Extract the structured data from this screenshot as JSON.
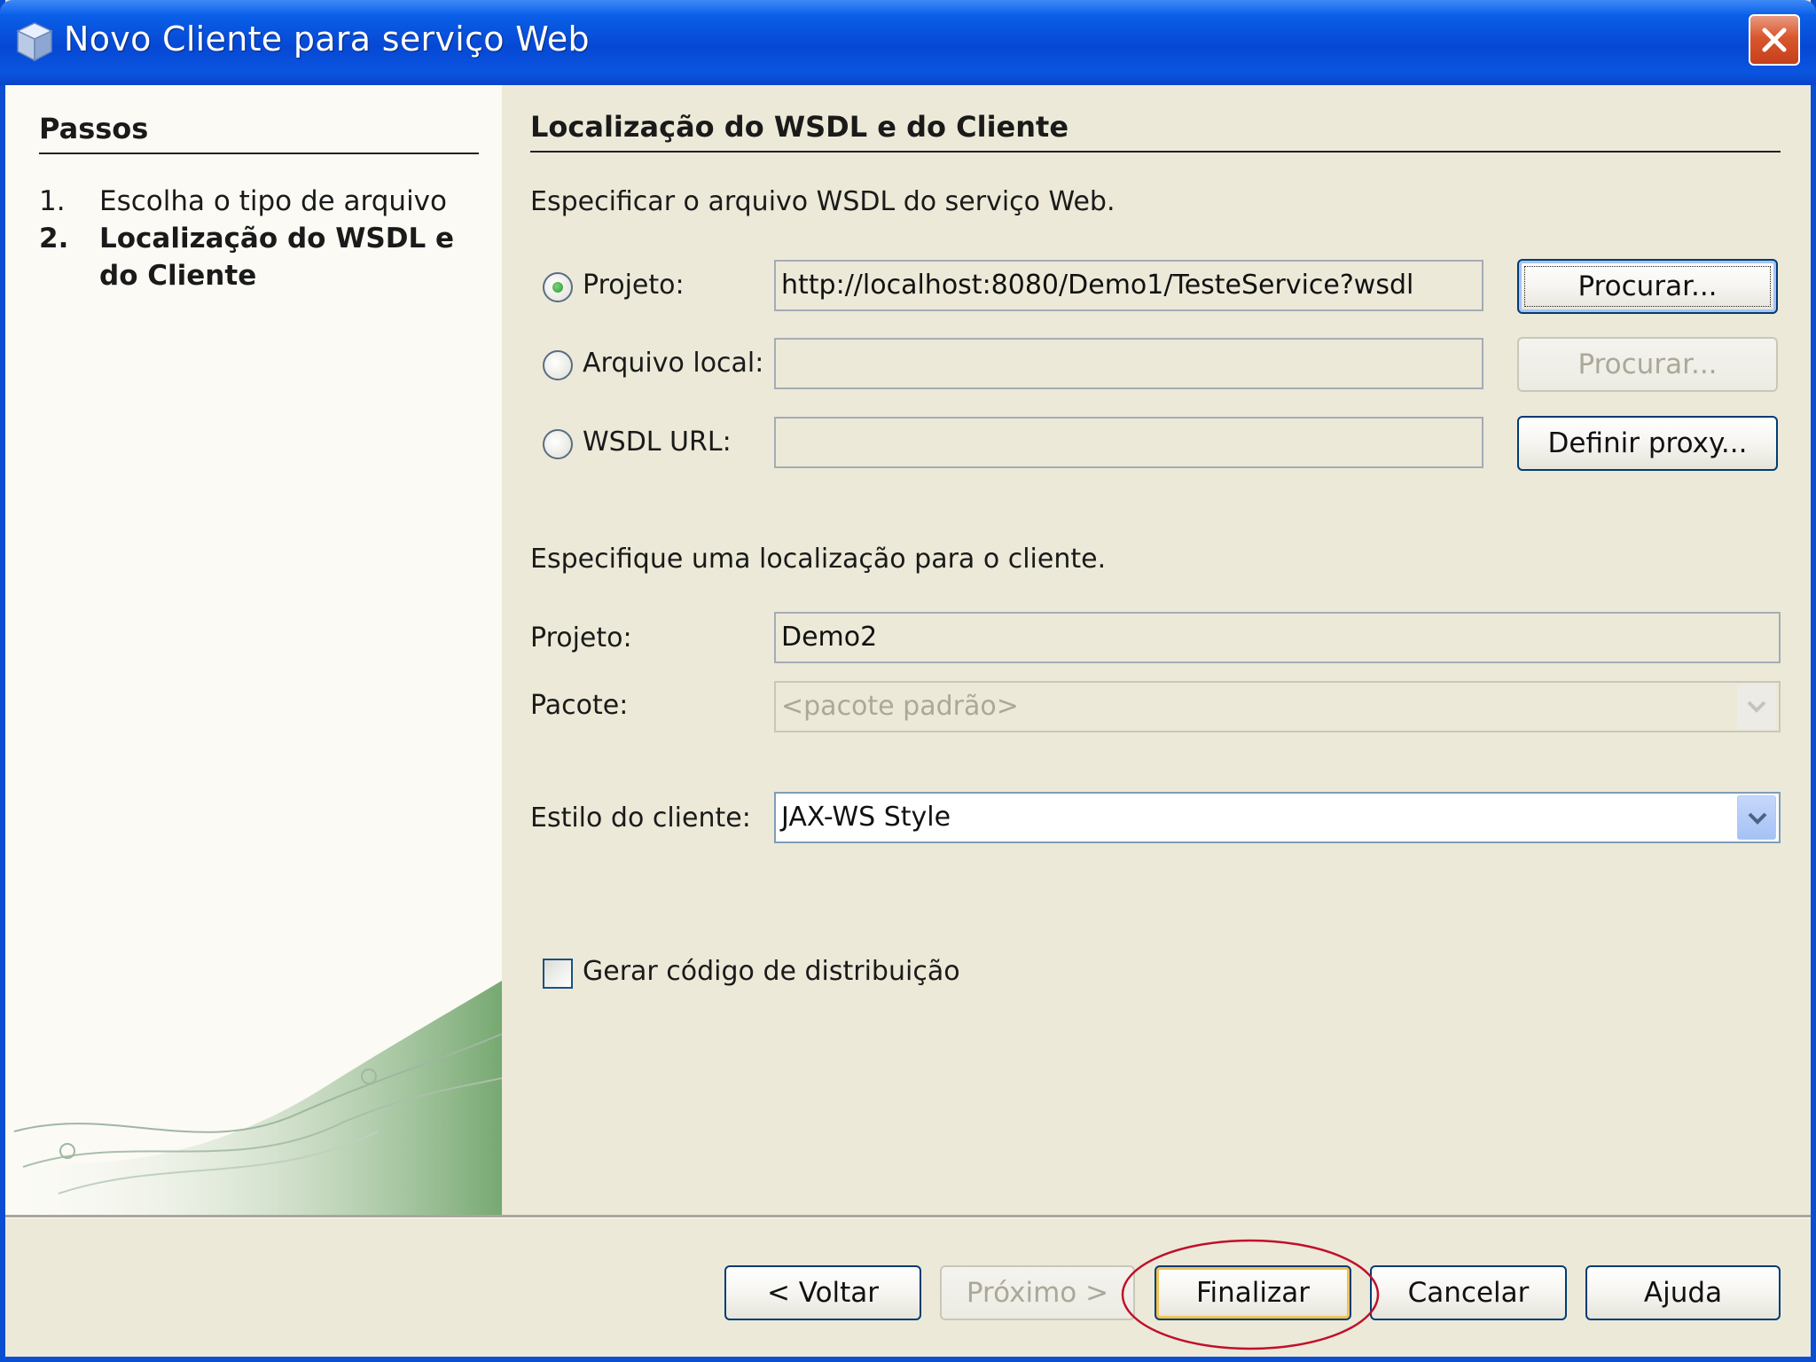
{
  "window": {
    "title": "Novo Cliente para serviço Web",
    "icon": "cube-icon",
    "close_icon": "close-icon"
  },
  "steps": {
    "heading": "Passos",
    "items": [
      {
        "num": "1.",
        "label": "Escolha o tipo de arquivo",
        "active": false
      },
      {
        "num": "2.",
        "label": "Localização do WSDL e do Cliente",
        "active": true
      }
    ]
  },
  "panel": {
    "title": "Localização do WSDL e do Cliente",
    "wsdl_instruction": "Especificar o arquivo WSDL do serviço Web.",
    "sources": [
      {
        "label": "Projeto:",
        "selected": true,
        "value": "http://localhost:8080/Demo1/TesteService?wsdl",
        "button": "Procurar...",
        "button_enabled": true
      },
      {
        "label": "Arquivo local:",
        "selected": false,
        "value": "",
        "button": "Procurar...",
        "button_enabled": false
      },
      {
        "label": "WSDL URL:",
        "selected": false,
        "value": "",
        "button": "Definir proxy...",
        "button_enabled": true
      }
    ],
    "client_instruction": "Especifique uma localização para o cliente.",
    "project_label": "Projeto:",
    "project_value": "Demo2",
    "package_label": "Pacote:",
    "package_placeholder": "<pacote padrão>",
    "style_label": "Estilo do cliente:",
    "style_value": "JAX-WS Style",
    "dispatch_label": "Gerar código de distribuição",
    "dispatch_checked": false
  },
  "footer": {
    "back": "< Voltar",
    "next": "Próximo >",
    "finish": "Finalizar",
    "cancel": "Cancelar",
    "help": "Ajuda"
  },
  "colors": {
    "titlebar": "#0648d4",
    "dialog_bg": "#ece9d8",
    "annotation": "#c0102a"
  }
}
